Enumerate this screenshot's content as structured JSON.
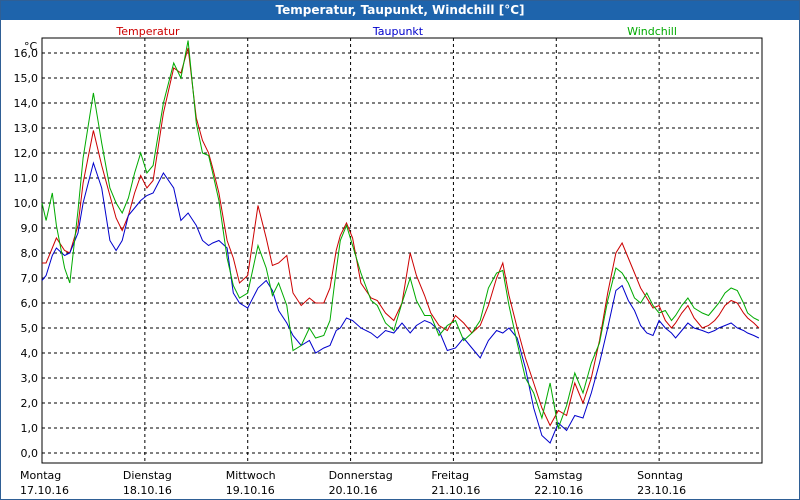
{
  "window": {
    "title": "Temperatur, Taupunkt, Windchill [°C]"
  },
  "chart_data": {
    "type": "line",
    "title": "Temperatur, Taupunkt, Windchill [°C]",
    "ylabel": "°C",
    "xlabel": "",
    "ylim": [
      -0.4,
      16.6
    ],
    "xlim": [
      0,
      7
    ],
    "y_ticks": [
      "0,0",
      "1,0",
      "2,0",
      "3,0",
      "4,0",
      "5,0",
      "6,0",
      "7,0",
      "8,0",
      "9,0",
      "10,0",
      "11,0",
      "12,0",
      "13,0",
      "14,0",
      "15,0",
      "16,0"
    ],
    "x_labels": [
      {
        "day": "Montag",
        "date": "17.10.16"
      },
      {
        "day": "Dienstag",
        "date": "18.10.16"
      },
      {
        "day": "Mittwoch",
        "date": "19.10.16"
      },
      {
        "day": "Donnerstag",
        "date": "20.10.16"
      },
      {
        "day": "Freitag",
        "date": "21.10.16"
      },
      {
        "day": "Samstag",
        "date": "22.10.16"
      },
      {
        "day": "Sonntag",
        "date": "23.10.16"
      }
    ],
    "grid": true,
    "legend_placement": "top",
    "series": [
      {
        "name": "Temperatur",
        "color": "#cc0000",
        "x": [
          0.0,
          0.04,
          0.1,
          0.14,
          0.22,
          0.27,
          0.35,
          0.4,
          0.5,
          0.58,
          0.66,
          0.72,
          0.78,
          0.84,
          0.9,
          0.96,
          1.02,
          1.08,
          1.18,
          1.28,
          1.35,
          1.42,
          1.5,
          1.56,
          1.62,
          1.66,
          1.72,
          1.8,
          1.86,
          1.92,
          2.0,
          2.1,
          2.18,
          2.24,
          2.3,
          2.38,
          2.44,
          2.52,
          2.6,
          2.66,
          2.74,
          2.8,
          2.86,
          2.9,
          2.96,
          3.02,
          3.1,
          3.2,
          3.26,
          3.34,
          3.42,
          3.5,
          3.58,
          3.64,
          3.72,
          3.78,
          3.86,
          3.94,
          4.02,
          4.1,
          4.18,
          4.26,
          4.34,
          4.42,
          4.48,
          4.54,
          4.62,
          4.7,
          4.78,
          4.86,
          4.94,
          5.02,
          5.1,
          5.18,
          5.26,
          5.34,
          5.42,
          5.5,
          5.58,
          5.64,
          5.7,
          5.76,
          5.82,
          5.88,
          5.94,
          6.0,
          6.06,
          6.12,
          6.16,
          6.22,
          6.28,
          6.34,
          6.42,
          6.48,
          6.54,
          6.58,
          6.64,
          6.7,
          6.76,
          6.82,
          6.86,
          6.92,
          6.97
        ],
        "values": [
          7.6,
          7.6,
          8.2,
          8.6,
          8.1,
          8.0,
          9.1,
          10.8,
          12.9,
          11.5,
          10.3,
          9.4,
          8.9,
          9.5,
          10.4,
          11.1,
          10.6,
          10.9,
          13.6,
          15.4,
          15.2,
          16.2,
          13.4,
          12.5,
          12.0,
          11.4,
          10.4,
          8.5,
          7.8,
          6.8,
          7.1,
          9.9,
          8.6,
          7.5,
          7.6,
          7.9,
          6.4,
          5.9,
          6.2,
          6.0,
          6.0,
          6.6,
          8.1,
          8.7,
          9.2,
          8.6,
          6.8,
          6.2,
          6.1,
          5.6,
          5.3,
          6.0,
          8.0,
          7.1,
          6.3,
          5.6,
          5.1,
          4.9,
          5.5,
          5.2,
          4.8,
          5.1,
          5.9,
          7.0,
          7.6,
          6.3,
          5.0,
          3.8,
          2.8,
          1.8,
          1.1,
          1.7,
          1.5,
          2.8,
          2.0,
          3.0,
          4.5,
          6.4,
          8.0,
          8.4,
          7.8,
          7.2,
          6.6,
          6.2,
          5.8,
          5.9,
          5.3,
          5.0,
          5.2,
          5.6,
          5.9,
          5.4,
          5.0,
          5.1,
          5.3,
          5.5,
          5.9,
          6.1,
          6.0,
          5.6,
          5.4,
          5.2,
          5.0
        ]
      },
      {
        "name": "Taupunkt",
        "color": "#0000cc",
        "x": [
          0.0,
          0.04,
          0.1,
          0.14,
          0.22,
          0.27,
          0.35,
          0.4,
          0.5,
          0.58,
          0.66,
          0.72,
          0.78,
          0.84,
          0.9,
          0.96,
          1.02,
          1.08,
          1.18,
          1.28,
          1.35,
          1.42,
          1.5,
          1.56,
          1.62,
          1.66,
          1.72,
          1.8,
          1.86,
          1.92,
          2.0,
          2.1,
          2.18,
          2.24,
          2.3,
          2.38,
          2.44,
          2.52,
          2.6,
          2.66,
          2.74,
          2.8,
          2.86,
          2.9,
          2.96,
          3.02,
          3.1,
          3.2,
          3.26,
          3.34,
          3.42,
          3.5,
          3.58,
          3.64,
          3.72,
          3.78,
          3.86,
          3.94,
          4.02,
          4.1,
          4.18,
          4.26,
          4.34,
          4.42,
          4.48,
          4.54,
          4.62,
          4.7,
          4.78,
          4.86,
          4.94,
          5.02,
          5.1,
          5.18,
          5.26,
          5.34,
          5.42,
          5.5,
          5.58,
          5.64,
          5.7,
          5.76,
          5.82,
          5.88,
          5.94,
          6.0,
          6.06,
          6.12,
          6.16,
          6.22,
          6.28,
          6.34,
          6.42,
          6.48,
          6.54,
          6.58,
          6.64,
          6.7,
          6.76,
          6.82,
          6.86,
          6.92,
          6.97
        ],
        "values": [
          6.9,
          7.1,
          7.9,
          8.2,
          7.9,
          8.0,
          8.8,
          10.0,
          11.6,
          10.6,
          8.5,
          8.1,
          8.5,
          9.5,
          9.8,
          10.1,
          10.3,
          10.4,
          11.2,
          10.6,
          9.3,
          9.6,
          9.1,
          8.5,
          8.3,
          8.4,
          8.5,
          8.2,
          6.4,
          6.0,
          5.8,
          6.6,
          6.9,
          6.5,
          5.7,
          5.2,
          4.7,
          4.3,
          4.5,
          4.0,
          4.2,
          4.3,
          4.9,
          5.0,
          5.4,
          5.3,
          5.0,
          4.8,
          4.6,
          4.9,
          4.8,
          5.2,
          4.8,
          5.1,
          5.3,
          5.2,
          4.9,
          4.1,
          4.2,
          4.6,
          4.2,
          3.8,
          4.5,
          4.9,
          4.8,
          5.0,
          4.6,
          3.4,
          1.8,
          0.7,
          0.4,
          1.2,
          0.9,
          1.5,
          1.4,
          2.4,
          3.6,
          5.0,
          6.5,
          6.7,
          6.1,
          5.7,
          5.1,
          4.8,
          4.7,
          5.3,
          5.0,
          4.8,
          4.6,
          4.9,
          5.2,
          5.0,
          4.9,
          4.8,
          4.9,
          5.0,
          5.1,
          5.2,
          5.0,
          4.9,
          4.8,
          4.7,
          4.6
        ]
      },
      {
        "name": "Windchill",
        "color": "#00aa00",
        "x": [
          0.0,
          0.04,
          0.1,
          0.14,
          0.22,
          0.27,
          0.35,
          0.4,
          0.5,
          0.58,
          0.66,
          0.72,
          0.78,
          0.84,
          0.9,
          0.96,
          1.02,
          1.08,
          1.18,
          1.28,
          1.35,
          1.42,
          1.5,
          1.56,
          1.62,
          1.66,
          1.72,
          1.8,
          1.86,
          1.92,
          2.0,
          2.1,
          2.18,
          2.24,
          2.3,
          2.38,
          2.44,
          2.52,
          2.6,
          2.66,
          2.74,
          2.8,
          2.86,
          2.9,
          2.96,
          3.02,
          3.1,
          3.2,
          3.26,
          3.34,
          3.42,
          3.5,
          3.58,
          3.64,
          3.72,
          3.78,
          3.86,
          3.94,
          4.02,
          4.1,
          4.18,
          4.26,
          4.34,
          4.42,
          4.48,
          4.54,
          4.62,
          4.7,
          4.78,
          4.86,
          4.94,
          5.02,
          5.1,
          5.18,
          5.26,
          5.34,
          5.42,
          5.5,
          5.58,
          5.64,
          5.7,
          5.76,
          5.82,
          5.88,
          5.94,
          6.0,
          6.06,
          6.12,
          6.16,
          6.22,
          6.28,
          6.34,
          6.42,
          6.48,
          6.54,
          6.58,
          6.64,
          6.7,
          6.76,
          6.82,
          6.86,
          6.92,
          6.97
        ],
        "values": [
          10.0,
          9.3,
          10.4,
          9.1,
          7.4,
          6.8,
          9.7,
          11.8,
          14.4,
          12.4,
          10.6,
          10.0,
          9.6,
          10.2,
          11.2,
          12.0,
          11.2,
          11.5,
          14.0,
          15.6,
          15.0,
          16.5,
          13.2,
          12.0,
          11.9,
          11.2,
          10.1,
          7.8,
          6.7,
          6.2,
          6.4,
          8.3,
          7.4,
          6.3,
          6.8,
          5.9,
          4.1,
          4.3,
          5.0,
          4.6,
          4.7,
          5.3,
          7.3,
          8.5,
          9.1,
          8.3,
          7.2,
          6.1,
          5.9,
          5.2,
          4.9,
          6.0,
          7.0,
          6.1,
          5.5,
          5.5,
          4.7,
          5.1,
          5.3,
          4.5,
          4.8,
          5.3,
          6.6,
          7.2,
          7.3,
          5.9,
          4.4,
          3.0,
          2.4,
          1.4,
          2.8,
          1.0,
          1.9,
          3.2,
          2.4,
          3.6,
          4.4,
          6.1,
          7.4,
          7.2,
          6.8,
          6.2,
          6.0,
          6.4,
          5.9,
          5.6,
          5.7,
          5.3,
          5.5,
          5.9,
          6.2,
          5.8,
          5.6,
          5.5,
          5.8,
          6.0,
          6.4,
          6.6,
          6.5,
          6.0,
          5.6,
          5.4,
          5.3
        ]
      }
    ]
  }
}
